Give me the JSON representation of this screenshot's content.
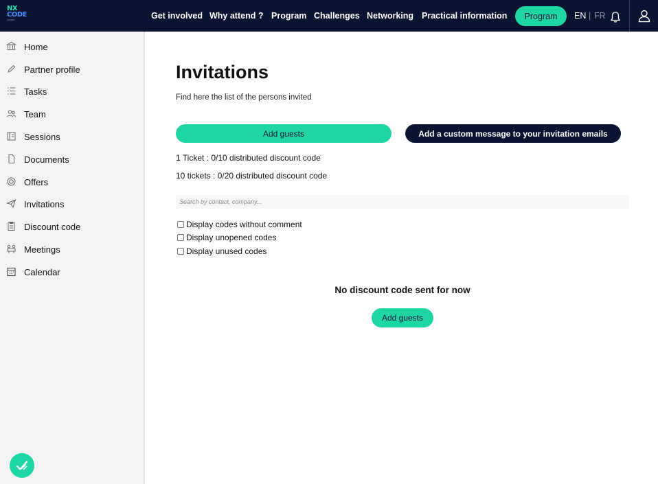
{
  "header": {
    "logo": {
      "line1": "NX",
      "line2": "CODE",
      "line3": "SUMMIT"
    },
    "nav": [
      "Get involved",
      "Why attend ?",
      "Program",
      "Challenges",
      "Networking",
      "Practical information"
    ],
    "program_button": "Program",
    "lang_en": "EN",
    "lang_sep": "|",
    "lang_fr": "FR"
  },
  "sidebar": {
    "items": [
      "Home",
      "Partner profile",
      "Tasks",
      "Team",
      "Sessions",
      "Documents",
      "Offers",
      "Invitations",
      "Discount code",
      "Meetings",
      "Calendar"
    ]
  },
  "main": {
    "title": "Invitations",
    "subtitle": "Find here the list of the persons invited",
    "add_guests_label": "Add guests",
    "custom_message_label": "Add a custom message to your invitation emails",
    "tickets": [
      "1 Ticket : 0/10 distributed discount code",
      "10 tickets : 0/20 distributed discount code"
    ],
    "search_placeholder": "Search by contact, company...",
    "filters": [
      "Display codes without comment",
      "Display unopened codes",
      "Display unused codes"
    ],
    "empty_message": "No discount code sent for now",
    "empty_add_label": "Add guests"
  },
  "colors": {
    "navy": "#0b1333",
    "accent": "#1ed6a4",
    "sidebar_bg": "#f4f4f4"
  }
}
